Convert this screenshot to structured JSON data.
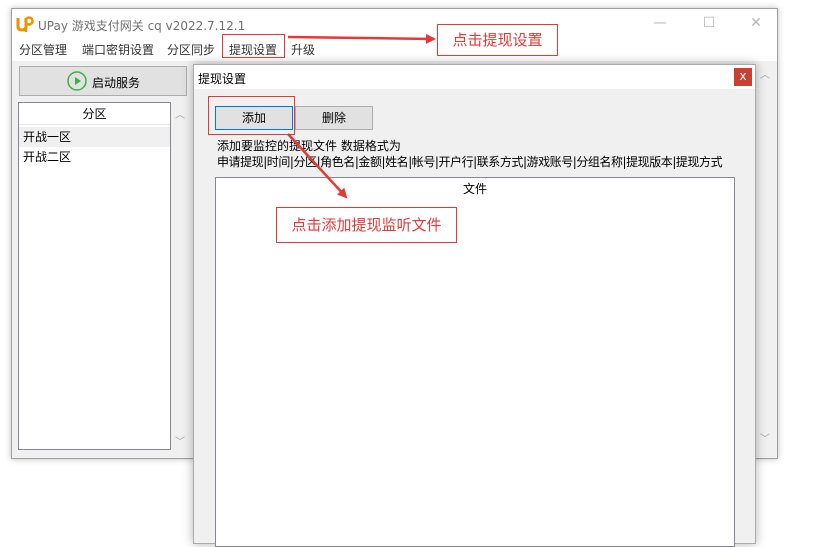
{
  "window": {
    "title": "UPay 游戏支付网关 cq v2022.7.12.1",
    "minimize": "—",
    "maximize": "☐",
    "close": "✕"
  },
  "menu": [
    "分区管理",
    "端口密钥设置",
    "分区同步",
    "提现设置",
    "升级"
  ],
  "start_button": {
    "label": "启动服务",
    "icon": "play-icon"
  },
  "zone_list": {
    "header": "分区",
    "items": [
      "开战一区",
      "开战二区"
    ]
  },
  "dialog": {
    "title": "提现设置",
    "close": "x",
    "add_label": "添加",
    "delete_label": "删除",
    "info_line1": "添加要监控的提现文件 数据格式为",
    "info_line2": "申请提现|时间|分区|角色名|金额|姓名|帐号|开户行|联系方式|游戏账号|分组名称|提现版本|提现方式",
    "file_column": "文件"
  },
  "annotations": {
    "callout_menu": "点击提现设置",
    "callout_add": "点击添加提现监听文件",
    "color": "#e53935"
  },
  "colors": {
    "accent": "#0078d7",
    "close_red": "#c84031",
    "play_green": "#3cb043"
  }
}
